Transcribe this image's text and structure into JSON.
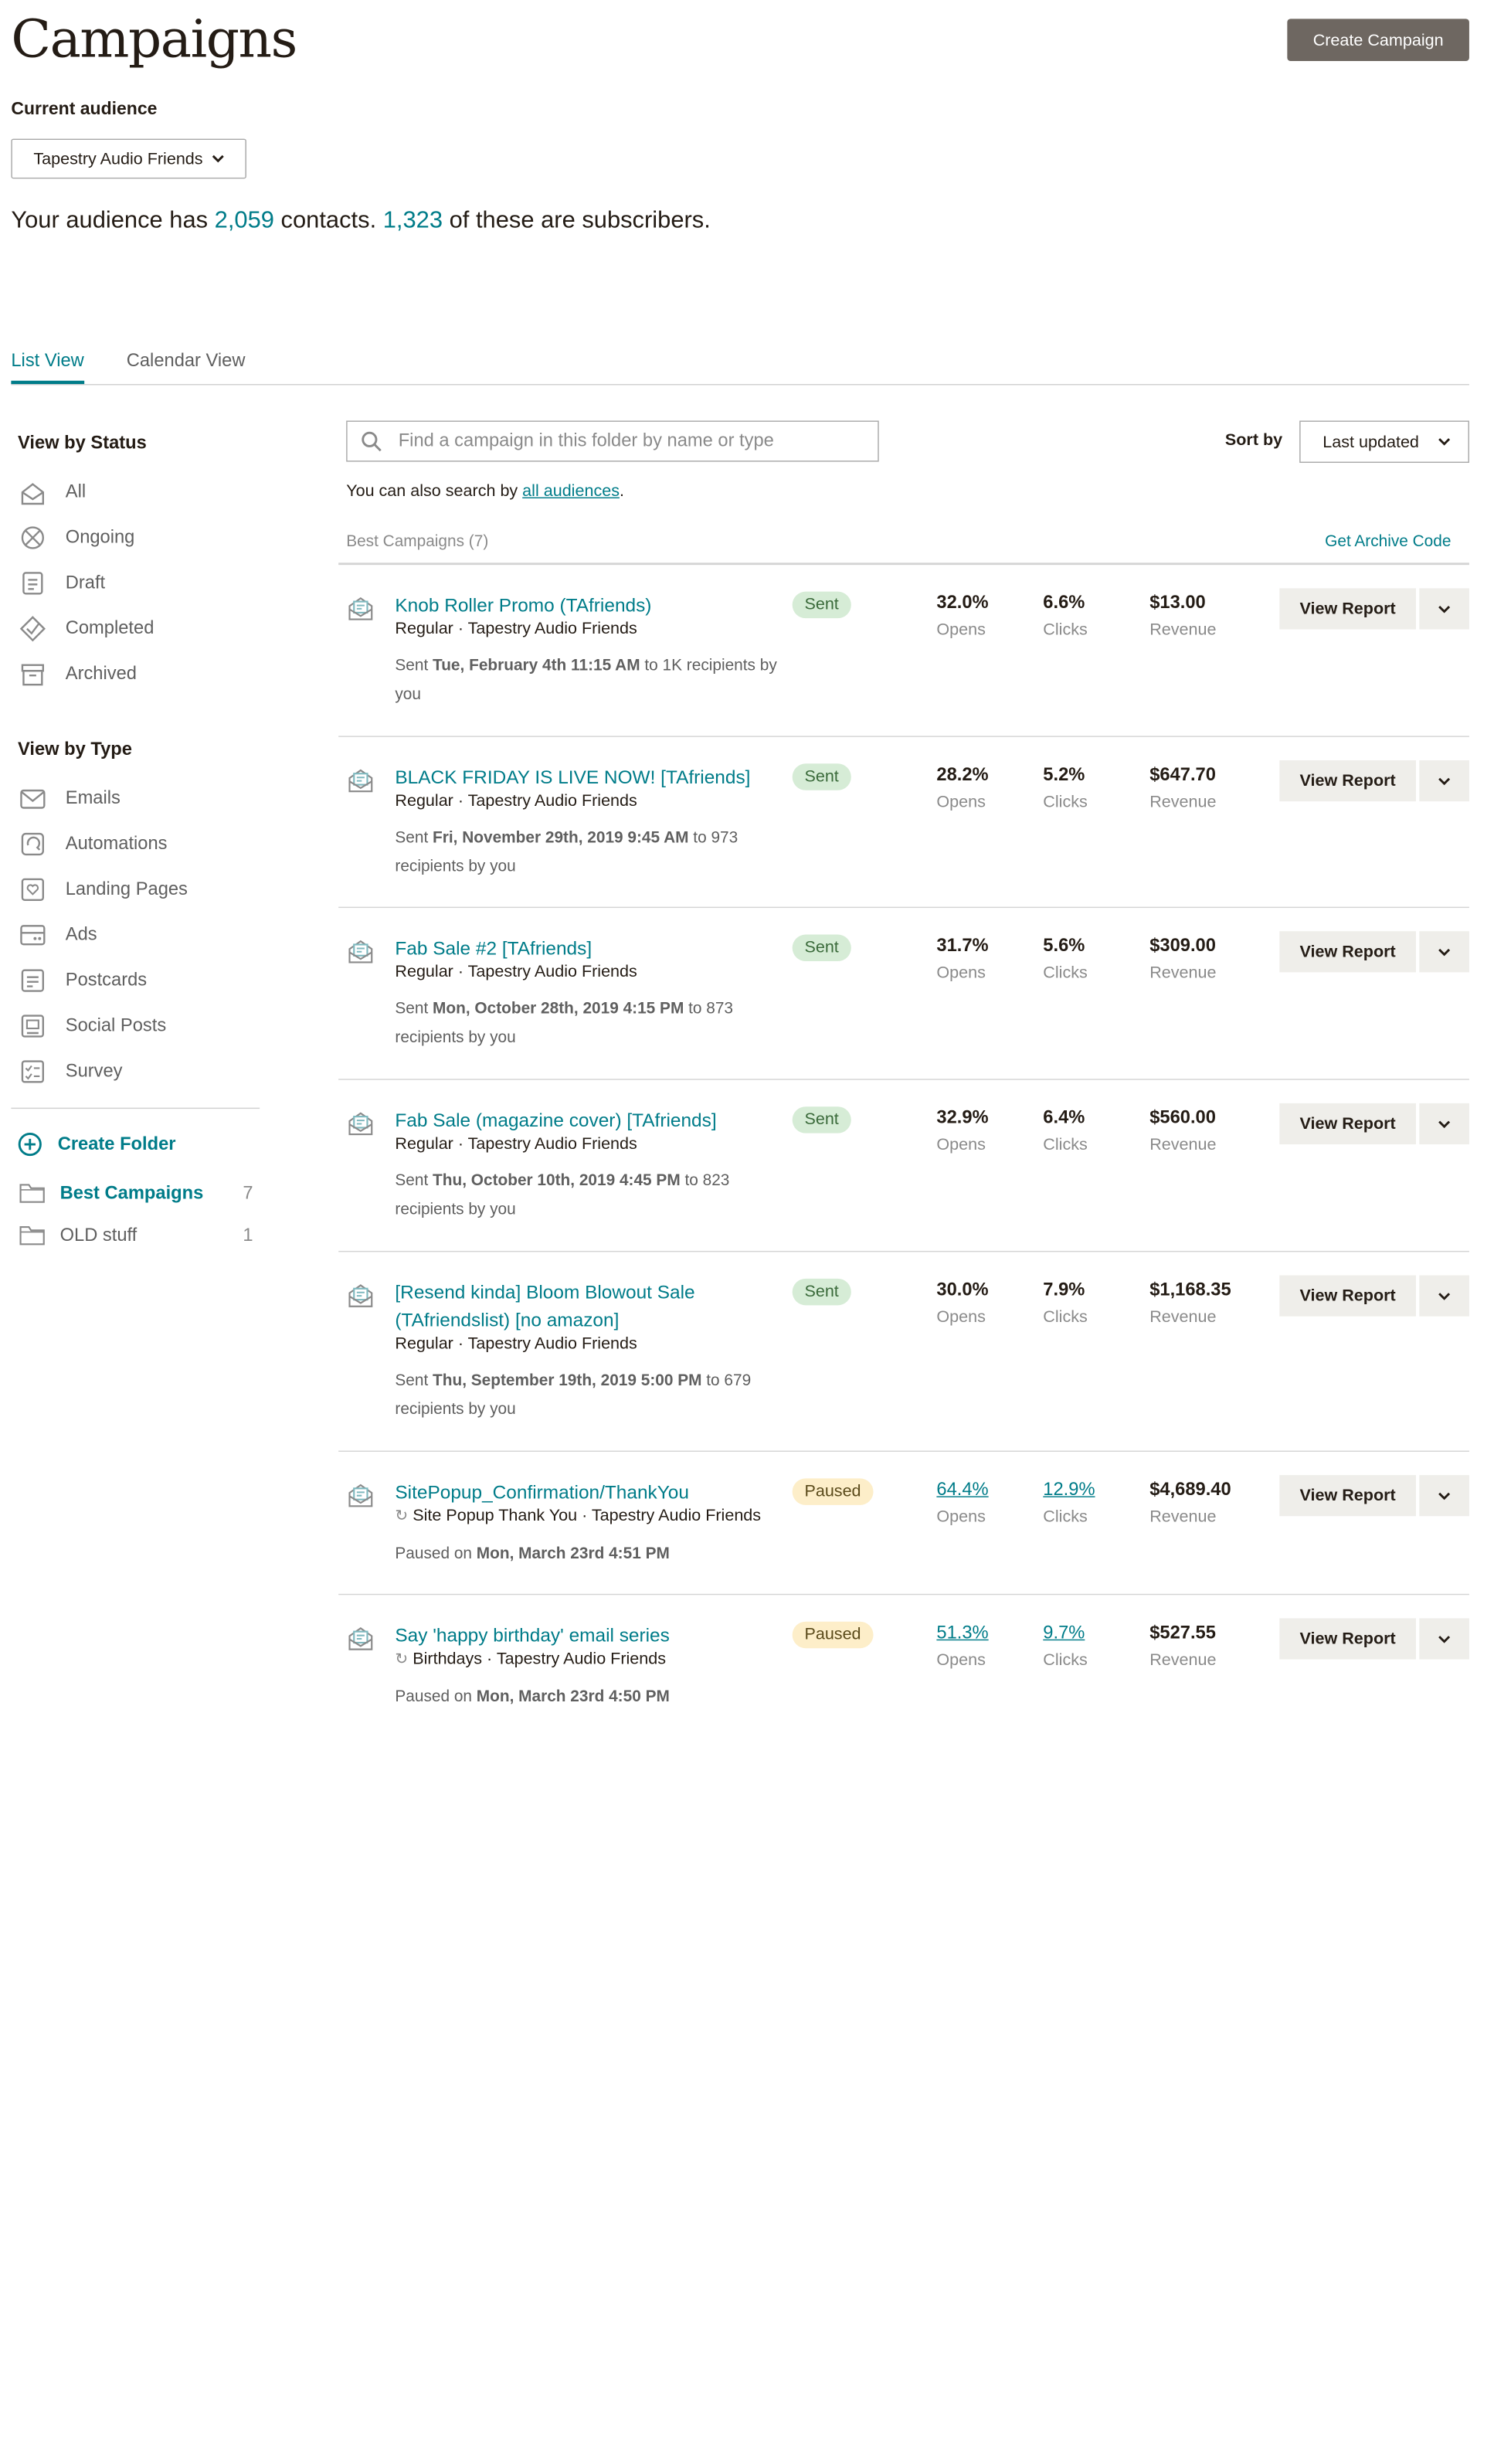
{
  "header": {
    "title": "Campaigns",
    "create_label": "Create Campaign"
  },
  "audience": {
    "label": "Current audience",
    "selected": "Tapestry Audio Friends",
    "summary_prefix": "Your audience has ",
    "contacts": "2,059",
    "summary_mid": " contacts. ",
    "subscribers": "1,323",
    "summary_suffix": " of these are subscribers."
  },
  "tabs": [
    {
      "label": "List View"
    },
    {
      "label": "Calendar View"
    }
  ],
  "sidebar": {
    "status_heading": "View by Status",
    "status_items": [
      {
        "label": "All",
        "icon": "envelope-stack-icon"
      },
      {
        "label": "Ongoing",
        "icon": "ongoing-icon"
      },
      {
        "label": "Draft",
        "icon": "draft-icon"
      },
      {
        "label": "Completed",
        "icon": "check-icon"
      },
      {
        "label": "Archived",
        "icon": "archive-icon"
      }
    ],
    "type_heading": "View by Type",
    "type_items": [
      {
        "label": "Emails",
        "icon": "email-icon"
      },
      {
        "label": "Automations",
        "icon": "automation-icon"
      },
      {
        "label": "Landing Pages",
        "icon": "landing-page-icon"
      },
      {
        "label": "Ads",
        "icon": "ads-icon"
      },
      {
        "label": "Postcards",
        "icon": "postcard-icon"
      },
      {
        "label": "Social Posts",
        "icon": "social-post-icon"
      },
      {
        "label": "Survey",
        "icon": "survey-icon"
      }
    ],
    "create_folder": "Create Folder",
    "folders": [
      {
        "name": "Best Campaigns",
        "count": "7",
        "active": true
      },
      {
        "name": "OLD stuff",
        "count": "1",
        "active": false
      }
    ]
  },
  "search": {
    "placeholder": "Find a campaign in this folder by name or type",
    "also_prefix": "You can also search by ",
    "also_link": "all audiences",
    "also_suffix": "."
  },
  "sort": {
    "label": "Sort by",
    "value": "Last updated"
  },
  "folder_header": {
    "title": "Best Campaigns (7)",
    "archive": "Get Archive Code"
  },
  "campaigns": [
    {
      "name": "Knob Roller Promo (TAfriends)",
      "type": "Regular",
      "audience": "Tapestry Audio Friends",
      "status": "Sent",
      "detail_prefix": "Sent ",
      "date": "Tue, February 4th 11:15 AM",
      "detail_suffix": " to 1K recipients by you",
      "opens": "32.0%",
      "clicks": "6.6%",
      "revenue": "$13.00"
    },
    {
      "name": "BLACK FRIDAY IS LIVE NOW! [TAfriends]",
      "type": "Regular",
      "audience": "Tapestry Audio Friends",
      "status": "Sent",
      "detail_prefix": "Sent ",
      "date": "Fri, November 29th, 2019 9:45 AM",
      "detail_suffix": " to 973 recipients by you",
      "opens": "28.2%",
      "clicks": "5.2%",
      "revenue": "$647.70"
    },
    {
      "name": "Fab Sale #2 [TAfriends]",
      "type": "Regular",
      "audience": "Tapestry Audio Friends",
      "status": "Sent",
      "detail_prefix": "Sent ",
      "date": "Mon, October 28th, 2019 4:15 PM",
      "detail_suffix": " to 873 recipients by you",
      "opens": "31.7%",
      "clicks": "5.6%",
      "revenue": "$309.00"
    },
    {
      "name": "Fab Sale (magazine cover) [TAfriends]",
      "type": "Regular",
      "audience": "Tapestry Audio Friends",
      "status": "Sent",
      "detail_prefix": "Sent ",
      "date": "Thu, October 10th, 2019 4:45 PM",
      "detail_suffix": " to 823 recipients by you",
      "opens": "32.9%",
      "clicks": "6.4%",
      "revenue": "$560.00"
    },
    {
      "name": "[Resend kinda] Bloom Blowout Sale (TAfriendslist) [no amazon]",
      "type": "Regular",
      "audience": "Tapestry Audio Friends",
      "status": "Sent",
      "detail_prefix": "Sent ",
      "date": "Thu, September 19th, 2019 5:00 PM",
      "detail_suffix": " to 679 recipients by you",
      "opens": "30.0%",
      "clicks": "7.9%",
      "revenue": "$1,168.35"
    },
    {
      "name": "SitePopup_Confirmation/ThankYou",
      "type": "Site Popup Thank You",
      "audience": "Tapestry Audio Friends",
      "status": "Paused",
      "detail_prefix": "Paused on ",
      "date": "Mon, March 23rd 4:51 PM",
      "detail_suffix": "",
      "opens": "64.4%",
      "clicks": "12.9%",
      "revenue": "$4,689.40"
    },
    {
      "name": "Say 'happy birthday' email series",
      "type": "Birthdays",
      "audience": "Tapestry Audio Friends",
      "status": "Paused",
      "detail_prefix": "Paused on ",
      "date": "Mon, March 23rd 4:50 PM",
      "detail_suffix": "",
      "opens": "51.3%",
      "clicks": "9.7%",
      "revenue": "$527.55"
    }
  ],
  "stat_labels": {
    "opens": "Opens",
    "clicks": "Clicks",
    "revenue": "Revenue"
  },
  "view_report_label": "View Report",
  "meta_separator": " · ",
  "colors": {
    "accent": "#007c89",
    "button_dark": "#6e6761",
    "sent_badge": "#d6ecd6",
    "paused_badge": "#fdeec9"
  }
}
